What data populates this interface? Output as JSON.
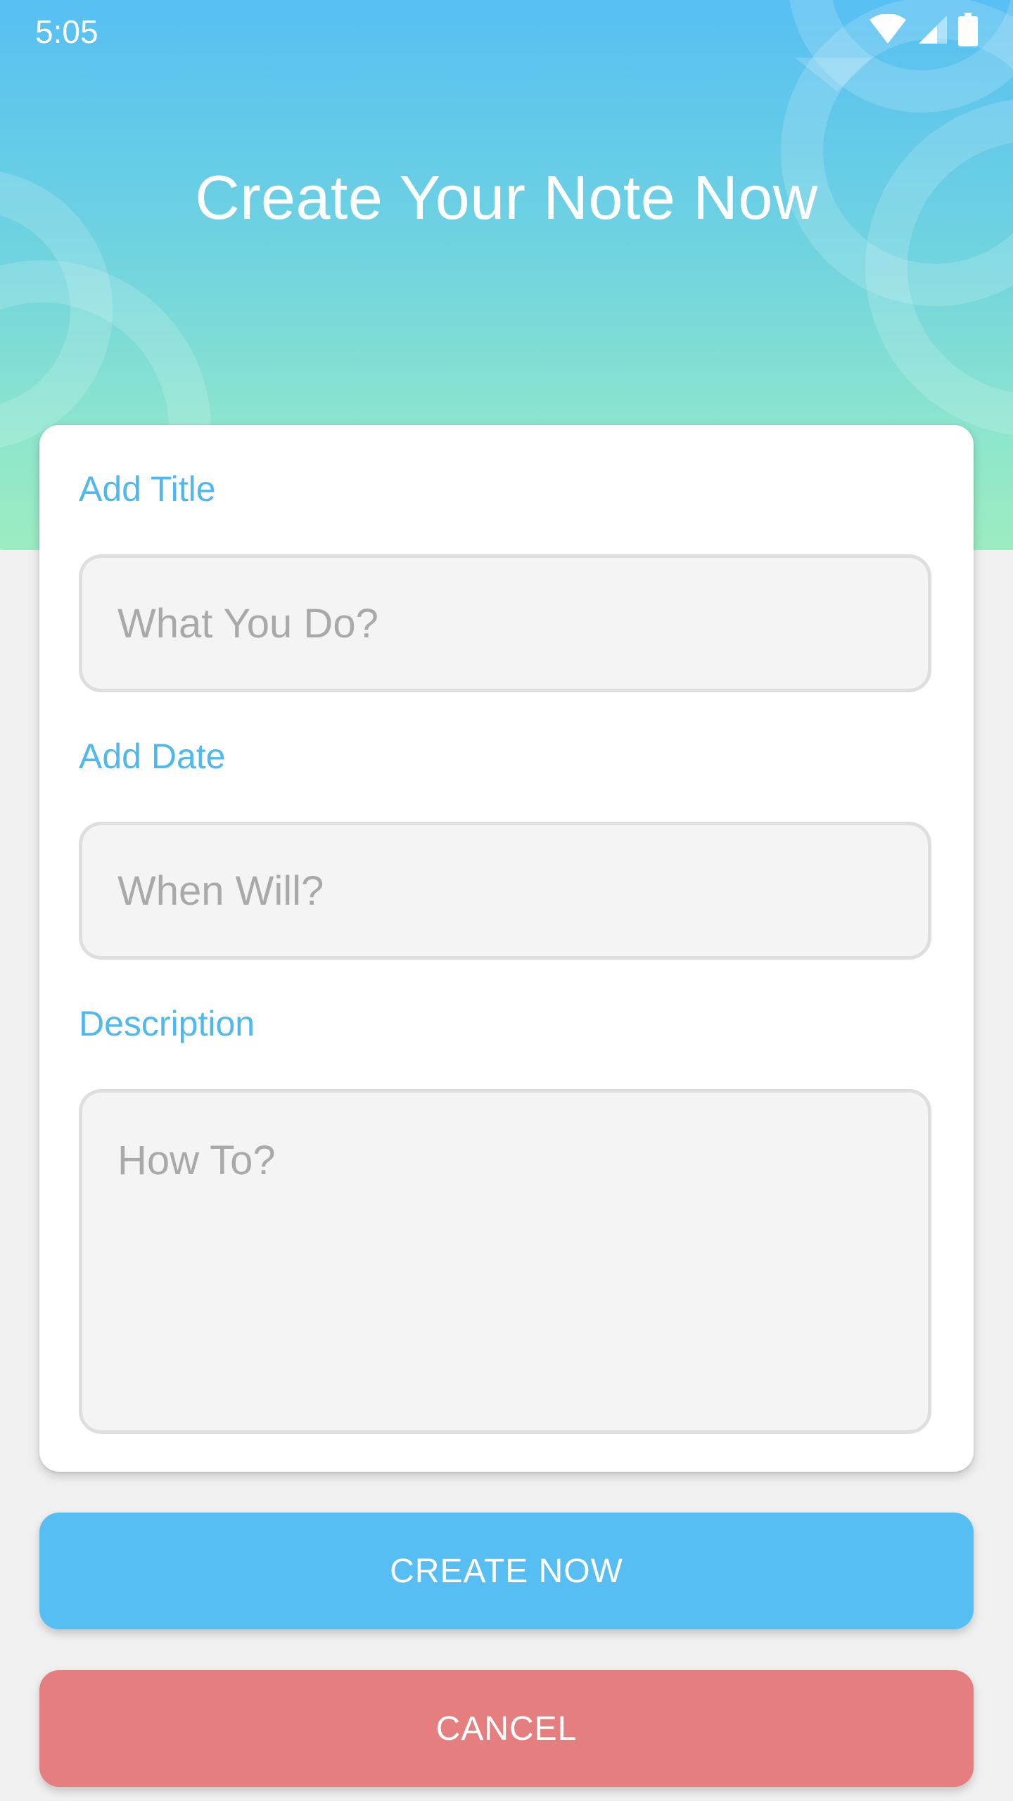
{
  "colors": {
    "accent": "#4fb9ee",
    "primary_button": "#56bef3",
    "cancel_button": "#e57f7f",
    "header_top": "#57bff3",
    "header_bottom": "#9cecc0"
  },
  "status_bar": {
    "time": "5:05",
    "icons": [
      "wifi-icon",
      "cell-signal-icon",
      "battery-icon"
    ]
  },
  "header": {
    "title": "Create Your Note Now"
  },
  "form": {
    "title_label": "Add Title",
    "title_placeholder": "What You Do?",
    "title_value": "",
    "date_label": "Add Date",
    "date_placeholder": "When Will?",
    "date_value": "",
    "description_label": "Description",
    "description_placeholder": "How To?",
    "description_value": ""
  },
  "actions": {
    "create_label": "CREATE NOW",
    "cancel_label": "CANCEL"
  }
}
